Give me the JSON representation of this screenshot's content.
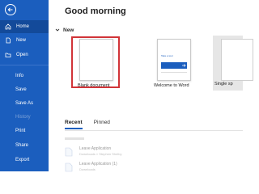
{
  "sidebar": {
    "bg": "#1b5ebe",
    "items": [
      {
        "label": "Home",
        "icon": "home-icon"
      },
      {
        "label": "New",
        "icon": "new-document-icon"
      },
      {
        "label": "Open",
        "icon": "folder-open-icon"
      },
      {
        "label": "Info"
      },
      {
        "label": "Save"
      },
      {
        "label": "Save As"
      },
      {
        "label": "History"
      },
      {
        "label": "Print"
      },
      {
        "label": "Share"
      },
      {
        "label": "Export"
      }
    ]
  },
  "main": {
    "greeting": "Good morning",
    "new_section": "New",
    "templates": [
      {
        "label": "Blank document"
      },
      {
        "label": "Welcome to Word",
        "mini_text": "Take a tour"
      },
      {
        "label": "Single sp"
      }
    ],
    "tabs": [
      {
        "label": "Recent"
      },
      {
        "label": "Pinned"
      }
    ],
    "recent": [
      {
        "name": "Leave Application",
        "path": "Downloads » Stephen Shelby"
      },
      {
        "name": "Leave Application (1)",
        "path": "Downloads"
      }
    ],
    "highlight_color": "#d13438"
  }
}
